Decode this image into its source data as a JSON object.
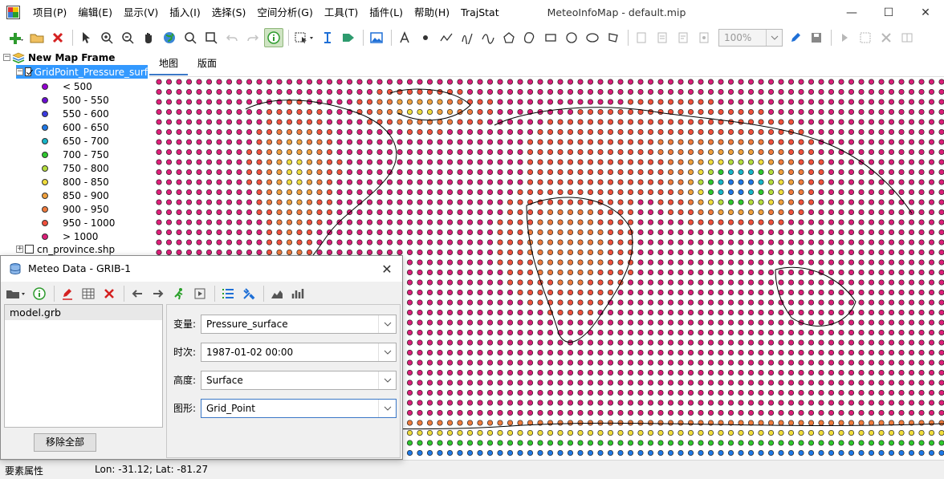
{
  "window": {
    "title": "MeteoInfoMap - default.mip",
    "menu": [
      "项目(P)",
      "编辑(E)",
      "显示(V)",
      "插入(I)",
      "选择(S)",
      "空间分析(G)",
      "工具(T)",
      "插件(L)",
      "帮助(H)",
      "TrajStat"
    ],
    "minimize_symbol": "—",
    "maximize_symbol": "☐",
    "close_symbol": "✕"
  },
  "toolbar": {
    "zoom_value": "100%"
  },
  "layer_tree": {
    "frame_label": "New Map Frame",
    "grid_layer": "GridPoint_Pressure_surf",
    "legend": [
      {
        "label": "< 500",
        "color": "#9400d3"
      },
      {
        "label": "500 - 550",
        "color": "#6a0dd3"
      },
      {
        "label": "550 - 600",
        "color": "#3a3adf"
      },
      {
        "label": "600 - 650",
        "color": "#1e78e6"
      },
      {
        "label": "650 - 700",
        "color": "#16b5c8"
      },
      {
        "label": "700 - 750",
        "color": "#2ec82e"
      },
      {
        "label": "750 - 800",
        "color": "#b4dc3c"
      },
      {
        "label": "800 - 850",
        "color": "#f0dc3c"
      },
      {
        "label": "850 - 900",
        "color": "#f0a03c"
      },
      {
        "label": "900 - 950",
        "color": "#f07a3c"
      },
      {
        "label": "950 - 1000",
        "color": "#f0503c"
      },
      {
        "label": "> 1000",
        "color": "#dc1e78"
      }
    ],
    "province_layer": "cn_province.shp"
  },
  "tabs": [
    "地图",
    "版面"
  ],
  "dialog": {
    "title": "Meteo Data - GRIB-1",
    "close_symbol": "✕",
    "files": [
      "model.grb"
    ],
    "remove_all_label": "移除全部",
    "fields": [
      {
        "label": "变量:",
        "value": "Pressure_surface"
      },
      {
        "label": "时次:",
        "value": "1987-01-02 00:00"
      },
      {
        "label": "高度:",
        "value": "Surface"
      },
      {
        "label": "图形:",
        "value": "Grid_Point"
      }
    ]
  },
  "status": {
    "left": "要素属性",
    "coords": "Lon: -31.12; Lat: -81.27"
  }
}
